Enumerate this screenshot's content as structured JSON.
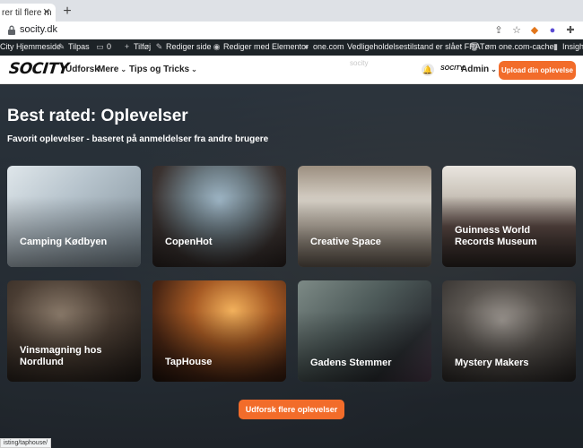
{
  "browser": {
    "tab_title": "rer til flere m",
    "url": "socity.dk"
  },
  "wpbar": {
    "site": "City Hjemmeside",
    "comments": "0",
    "tilpas": "Tilpas",
    "add": "Tilføj",
    "edit": "Rediger side",
    "elementor": "Rediger med Elementor",
    "onecom": "one.com",
    "maintenance": "Vedligeholdelsestilstand er slået FRA",
    "cache": "Tøm one.com-cache",
    "insight": "Insight"
  },
  "header": {
    "logo": "SOCITY",
    "nav_udforsk": "Udforsk",
    "nav_mere": "Mere",
    "nav_tips": "Tips og Tricks",
    "ghost": "socity",
    "mini_logo": "SOCITY",
    "admin": "Admin",
    "cta": "Upload din oplevelse"
  },
  "hero": {
    "title": "Best rated: Oplevelser",
    "subtitle": "Favorit oplevelser - baseret på anmeldelser fra andre brugere"
  },
  "cards": [
    {
      "label": "Camping Kødbyen"
    },
    {
      "label": "CopenHot"
    },
    {
      "label": "Creative Space"
    },
    {
      "label": "Guinness World Records Museum"
    },
    {
      "label": "Vinsmagning hos Nordlund"
    },
    {
      "label": "TapHouse"
    },
    {
      "label": "Gadens Stemmer"
    },
    {
      "label": "Mystery Makers"
    }
  ],
  "cta_bottom": "Udforsk flere oplevelser",
  "status_url": "isting/taphouse/",
  "colors": {
    "accent": "#f26c2a",
    "wpbar": "#1d2327"
  }
}
